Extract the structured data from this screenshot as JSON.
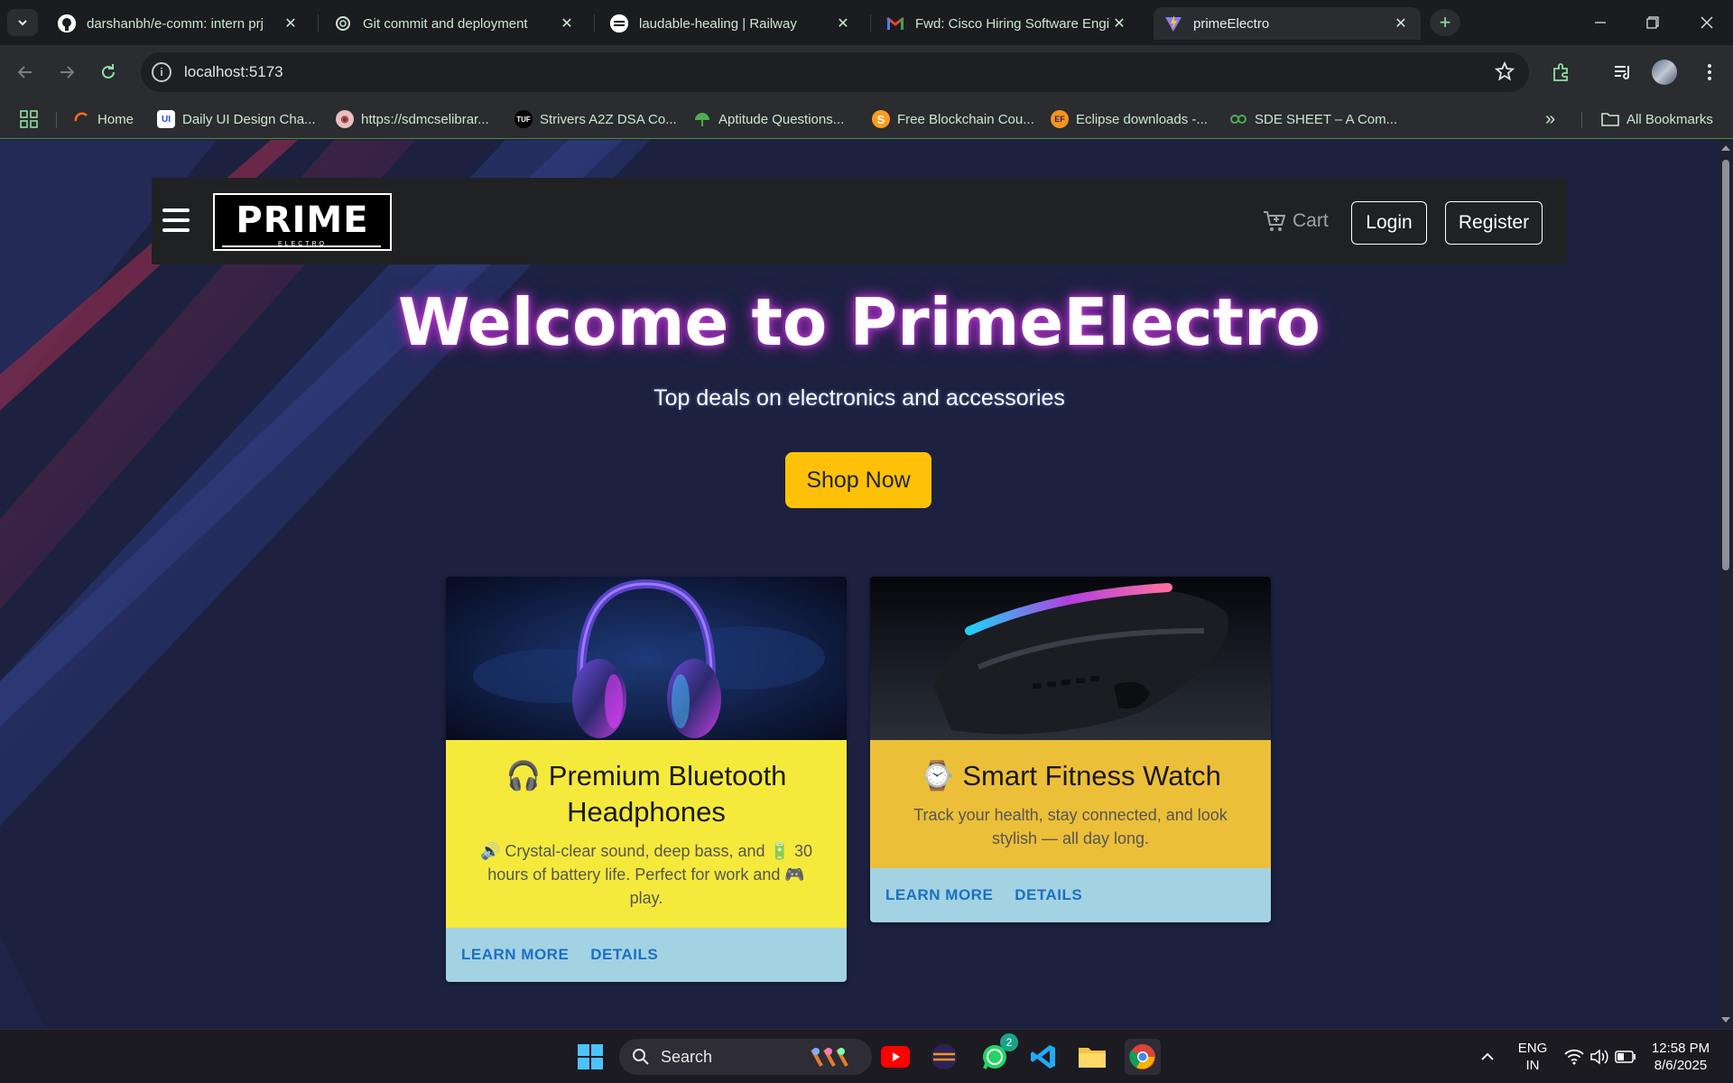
{
  "browser": {
    "tabs": [
      {
        "title": "darshanbh/e-comm: intern prj",
        "icon": "github-icon"
      },
      {
        "title": "Git commit and deployment",
        "icon": "openai-icon"
      },
      {
        "title": "laudable-healing | Railway",
        "icon": "railway-icon"
      },
      {
        "title": "Fwd: Cisco Hiring Software Engi",
        "icon": "gmail-icon"
      },
      {
        "title": "primeElectro",
        "icon": "vite-icon",
        "active": true
      }
    ],
    "url": "localhost:5173",
    "bookmarks": [
      {
        "label": "Home",
        "icon": "home-bookmark-icon"
      },
      {
        "label": "Daily UI Design Cha...",
        "icon": "ui-bookmark-icon"
      },
      {
        "label": "https://sdmcselibrar...",
        "icon": "library-bookmark-icon"
      },
      {
        "label": "Strivers A2Z DSA Co...",
        "icon": "tuf-bookmark-icon"
      },
      {
        "label": "Aptitude Questions...",
        "icon": "aptitude-bookmark-icon"
      },
      {
        "label": "Free Blockchain Cou...",
        "icon": "blockchain-bookmark-icon"
      },
      {
        "label": "Eclipse downloads -...",
        "icon": "eclipse-bookmark-icon"
      },
      {
        "label": "SDE SHEET – A Com...",
        "icon": "sde-bookmark-icon"
      }
    ],
    "all_bookmarks": "All Bookmarks",
    "chevrons": "»"
  },
  "navbar": {
    "logo_text": "PRIME",
    "logo_sub": "ELECTRO",
    "cart_label": "Cart",
    "login_label": "Login",
    "register_label": "Register"
  },
  "hero": {
    "title": "Welcome to PrimeElectro",
    "subtitle": "Top deals on electronics and accessories",
    "cta": "Shop Now"
  },
  "products": [
    {
      "emoji": "🎧",
      "title": "Premium Bluetooth Headphones",
      "description": "🔊 Crystal-clear sound, deep bass, and 🔋 30 hours of battery life. Perfect for work and 🎮 play.",
      "background": "#f5ea3b",
      "learn_more": "LEARN MORE",
      "details": "DETAILS"
    },
    {
      "emoji": "⌚",
      "title": "Smart Fitness Watch",
      "description": "Track your health, stay connected, and look stylish — all day long.",
      "background": "#ecbf38",
      "learn_more": "LEARN MORE",
      "details": "DETAILS"
    }
  ],
  "taskbar": {
    "search_label": "Search",
    "whatsapp_badge": "2",
    "lang_top": "ENG",
    "lang_bottom": "IN",
    "time": "12:58 PM",
    "date": "8/6/2025"
  },
  "colors": {
    "page_bg": "#1c2140",
    "cta_bg": "#ffc107",
    "actions_bg": "#a3d3e2",
    "link_blue": "#1c6fc4",
    "tab_text": "#c9e9d0"
  }
}
